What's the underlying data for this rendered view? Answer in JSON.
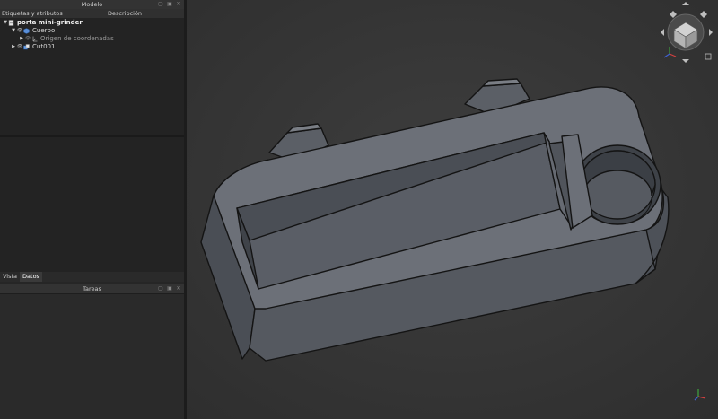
{
  "model_panel": {
    "title": "Modelo",
    "col_labels": "Etiquetas y atributos",
    "col_description": "Descripción",
    "tree": [
      {
        "label": "porta mini-grinder",
        "icon": "document-icon",
        "expanded": true
      },
      {
        "label": "Cuerpo",
        "icon": "body-icon",
        "expanded": true
      },
      {
        "label": "Origen de coordenadas",
        "icon": "axes-icon",
        "expanded": false
      },
      {
        "label": "Cut001",
        "icon": "cut-icon",
        "expanded": false
      }
    ],
    "tabs": [
      "Vista",
      "Datos"
    ],
    "active_tab": "Datos"
  },
  "tasks_panel": {
    "title": "Tareas"
  },
  "nav_cube": {
    "icon": "navigation-cube-icon"
  },
  "axis_indicator": {
    "icon": "axis-triad-icon"
  }
}
